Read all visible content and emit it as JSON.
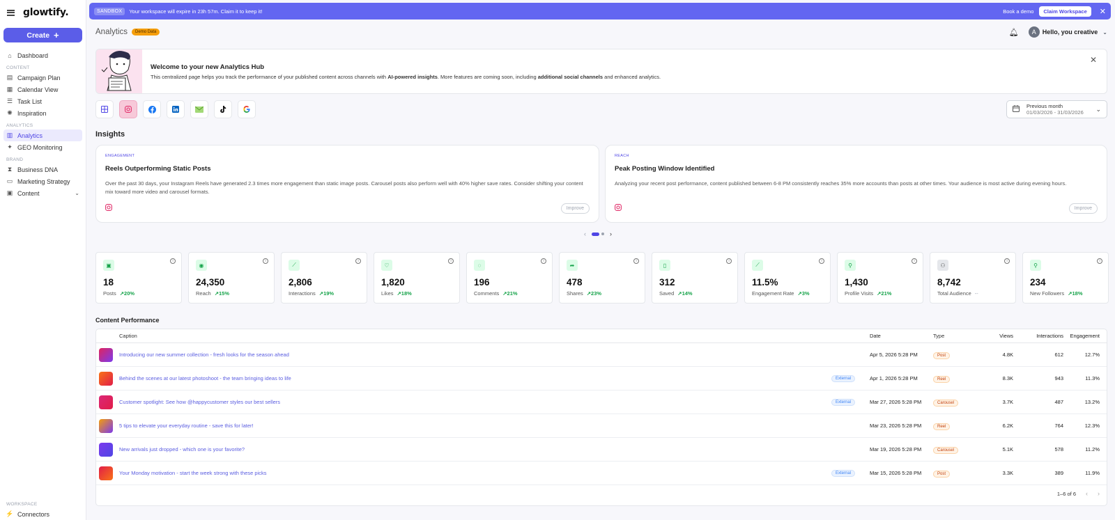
{
  "app": {
    "logo": "glowtify."
  },
  "sidebar": {
    "create_label": "Create",
    "dashboard": "Dashboard",
    "content_section": "CONTENT",
    "content_items": [
      "Campaign Plan",
      "Calendar View",
      "Task List",
      "Inspiration"
    ],
    "analytics_section": "ANALYTICS",
    "analytics_items": [
      "Analytics",
      "GEO Monitoring"
    ],
    "brand_section": "BRAND",
    "brand_items": [
      "Business DNA",
      "Marketing Strategy",
      "Content"
    ],
    "workspace_section": "WORKSPACE",
    "workspace_items": [
      "Connectors"
    ]
  },
  "banner": {
    "pill": "SANDBOX",
    "message": "Your workspace will expire in 23h 57m. Claim it to keep it!",
    "book_demo": "Book a demo",
    "claim": "Claim Workspace",
    "color": "#6366f1"
  },
  "header": {
    "title": "Analytics",
    "badge": "Demo Data",
    "greeting": "Hello, you creative",
    "avatar_letter": "A"
  },
  "welcome": {
    "title": "Welcome to your new Analytics Hub",
    "desc_1": "This centralized page helps you track the performance of your published content across channels with ",
    "desc_b1": "AI-powered insights",
    "desc_2": ". More features are coming soon, including ",
    "desc_b2": "additional social channels",
    "desc_3": " and enhanced analytics."
  },
  "channels": [
    {
      "icon": "grid-icon",
      "active": false
    },
    {
      "icon": "instagram-icon",
      "active": true
    },
    {
      "icon": "facebook-icon",
      "active": false
    },
    {
      "icon": "linkedin-icon",
      "active": false
    },
    {
      "icon": "email-icon",
      "active": false
    },
    {
      "icon": "tiktok-icon",
      "active": false
    },
    {
      "icon": "google-icon",
      "active": false
    }
  ],
  "date_range": {
    "label": "Previous month",
    "range": "01/03/2026 - 31/03/2026"
  },
  "insights": {
    "title": "Insights",
    "cards": [
      {
        "tag": "ENGAGEMENT",
        "title": "Reels Outperforming Static Posts",
        "desc": "Over the past 30 days, your Instagram Reels have generated 2.3 times more engagement than static image posts. Carousel posts also perform well with 40% higher save rates. Consider shifting your content mix toward more video and carousel formats.",
        "improve": "Improve"
      },
      {
        "tag": "REACH",
        "title": "Peak Posting Window Identified",
        "desc": "Analyzing your recent post performance, content published between 6-8 PM consistently reaches 35% more accounts than posts at other times. Your audience is most active during evening hours.",
        "improve": "Improve"
      }
    ]
  },
  "metrics": [
    {
      "value": "18",
      "label": "Posts",
      "change": "↗20%"
    },
    {
      "value": "24,350",
      "label": "Reach",
      "change": "↗15%"
    },
    {
      "value": "2,806",
      "label": "Interactions",
      "change": "↗19%"
    },
    {
      "value": "1,820",
      "label": "Likes",
      "change": "↗18%"
    },
    {
      "value": "196",
      "label": "Comments",
      "change": "↗21%"
    },
    {
      "value": "478",
      "label": "Shares",
      "change": "↗23%"
    },
    {
      "value": "312",
      "label": "Saved",
      "change": "↗14%"
    },
    {
      "value": "11.5%",
      "label": "Engagement Rate",
      "change": "↗3%"
    },
    {
      "value": "1,430",
      "label": "Profile Visits",
      "change": "↗21%"
    },
    {
      "value": "8,742",
      "label": "Total Audience",
      "change": "--"
    },
    {
      "value": "234",
      "label": "New Followers",
      "change": "↗18%"
    }
  ],
  "content_performance": {
    "title": "Content Performance",
    "columns": {
      "caption": "Caption",
      "date": "Date",
      "type": "Type",
      "views": "Views",
      "interactions": "Interactions",
      "engagement": "Engagement"
    },
    "rows": [
      {
        "caption": "Introducing our new summer collection - fresh looks for the season ahead",
        "external": "",
        "date": "Apr 5, 2026 5:28 PM",
        "type": "Post",
        "views": "4.8K",
        "interactions": "612",
        "engagement": "12.7%"
      },
      {
        "caption": "Behind the scenes at our latest photoshoot - the team bringing ideas to life",
        "external": "External",
        "date": "Apr 1, 2026 5:28 PM",
        "type": "Reel",
        "views": "8.3K",
        "interactions": "943",
        "engagement": "11.3%"
      },
      {
        "caption": "Customer spotlight: See how @happycustomer styles our best sellers",
        "external": "External",
        "date": "Mar 27, 2026 5:28 PM",
        "type": "Carousel",
        "views": "3.7K",
        "interactions": "487",
        "engagement": "13.2%"
      },
      {
        "caption": "5 tips to elevate your everyday routine - save this for later!",
        "external": "",
        "date": "Mar 23, 2026 5:28 PM",
        "type": "Reel",
        "views": "6.2K",
        "interactions": "764",
        "engagement": "12.3%"
      },
      {
        "caption": "New arrivals just dropped - which one is your favorite?",
        "external": "",
        "date": "Mar 19, 2026 5:28 PM",
        "type": "Carousel",
        "views": "5.1K",
        "interactions": "578",
        "engagement": "11.2%"
      },
      {
        "caption": "Your Monday motivation - start the week strong with these picks",
        "external": "External",
        "date": "Mar 15, 2026 5:28 PM",
        "type": "Post",
        "views": "3.3K",
        "interactions": "389",
        "engagement": "11.9%"
      }
    ],
    "pagination": "1–6 of 6"
  }
}
